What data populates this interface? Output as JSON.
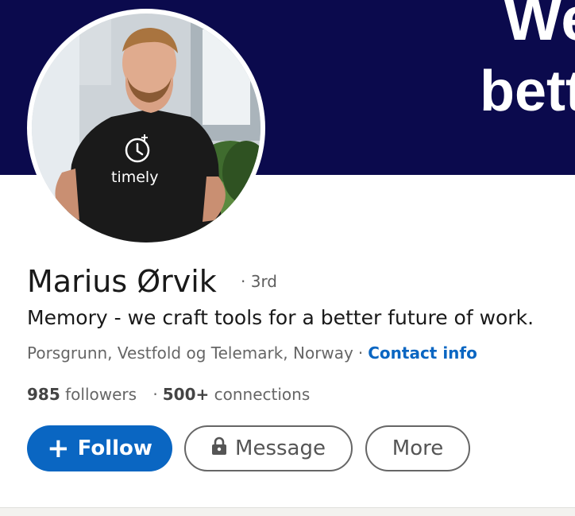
{
  "banner": {
    "line1": "We",
    "line2": "bett",
    "background": "#0b0a4d"
  },
  "avatar": {
    "shirt_brand": "timely"
  },
  "profile": {
    "name": "Marius Ørvik",
    "degree": "· 3rd",
    "headline": "Memory - we craft tools for a better future of work.",
    "location": "Porsgrunn, Vestfold og Telemark, Norway",
    "separator": "·",
    "contact_info": "Contact info"
  },
  "stats": {
    "followers_count": "985",
    "followers_label": "followers",
    "separator": "·",
    "connections_count": "500+",
    "connections_label": "connections"
  },
  "actions": {
    "follow_plus": "+",
    "follow_label": "Follow",
    "message_label": "Message",
    "more_label": "More",
    "message_icon": "lock-icon"
  },
  "colors": {
    "accent": "#0a66c2",
    "text": "#191919",
    "muted": "#666666"
  }
}
